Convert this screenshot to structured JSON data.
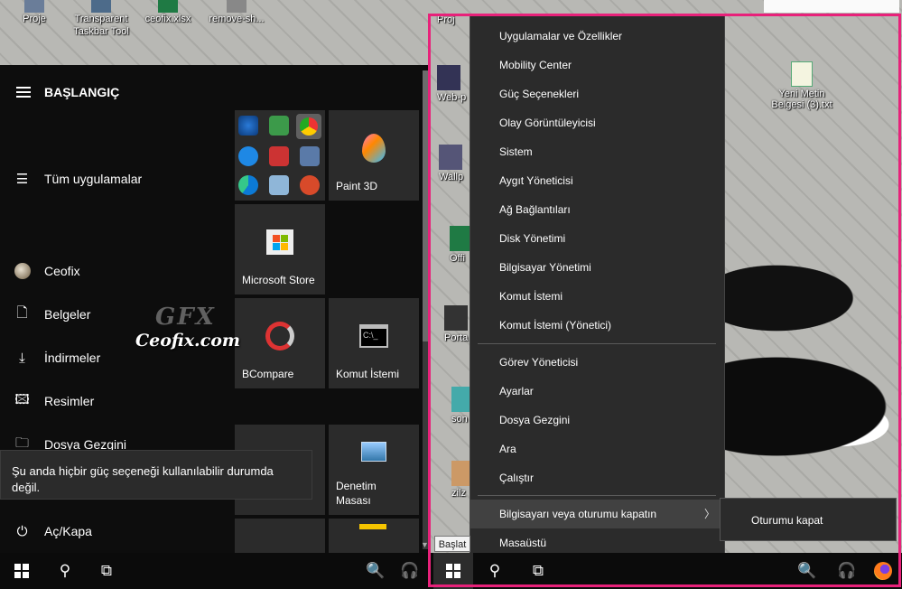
{
  "desktop_top_icons": [
    {
      "label": "Proje"
    },
    {
      "label": "Transparent Taskbar Tool"
    },
    {
      "label": "ceofix.xlsx"
    },
    {
      "label": "remove-sh..."
    }
  ],
  "start_menu": {
    "title": "BAŞLANGIÇ",
    "all_apps": "Tüm uygulamalar",
    "user": "Ceofix",
    "items": [
      {
        "label": "Belgeler",
        "icon": "document-icon"
      },
      {
        "label": "İndirmeler",
        "icon": "download-icon"
      },
      {
        "label": "Resimler",
        "icon": "pictures-icon"
      },
      {
        "label": "Dosya Gezgini",
        "icon": "folder-icon"
      }
    ],
    "power": "Aç/Kapa",
    "tooltip": "Şu anda hiçbir güç seçeneği kullanılabilir durumda değil.",
    "tiles": {
      "paint3d": "Paint 3D",
      "store": "Microsoft Store",
      "bcompare": "BCompare",
      "cmd": "Komut İstemi",
      "control_panel": "Denetim Masası"
    }
  },
  "watermark": {
    "gfx": "GFX",
    "site": "Ceofix.com"
  },
  "right_desktop": {
    "icons": [
      {
        "label": "Proj"
      },
      {
        "label": "Web-p"
      },
      {
        "label": "Wallp"
      },
      {
        "label": "Offi"
      },
      {
        "label": "Porta"
      },
      {
        "label": "son"
      },
      {
        "label": "zilz"
      }
    ],
    "text_file": "Yeni Metin Belgesi (3).txt"
  },
  "context_menu": {
    "group1": [
      "Uygulamalar ve Özellikler",
      "Mobility Center",
      "Güç Seçenekleri",
      "Olay Görüntüleyicisi",
      "Sistem",
      "Aygıt Yöneticisi",
      "Ağ Bağlantıları",
      "Disk Yönetimi",
      "Bilgisayar Yönetimi",
      "Komut İstemi",
      "Komut İstemi (Yönetici)"
    ],
    "group2": [
      "Görev Yöneticisi",
      "Ayarlar",
      "Dosya Gezgini",
      "Ara",
      "Çalıştır"
    ],
    "shutdown": "Bilgisayarı veya oturumu kapatın",
    "desktop": "Masaüstü",
    "submenu": "Oturumu kapat"
  },
  "start_tooltip": "Başlat",
  "colors": {
    "frame": "#e8217a",
    "menu_bg": "#2b2b2b",
    "start_bg": "#0d0d0d"
  }
}
